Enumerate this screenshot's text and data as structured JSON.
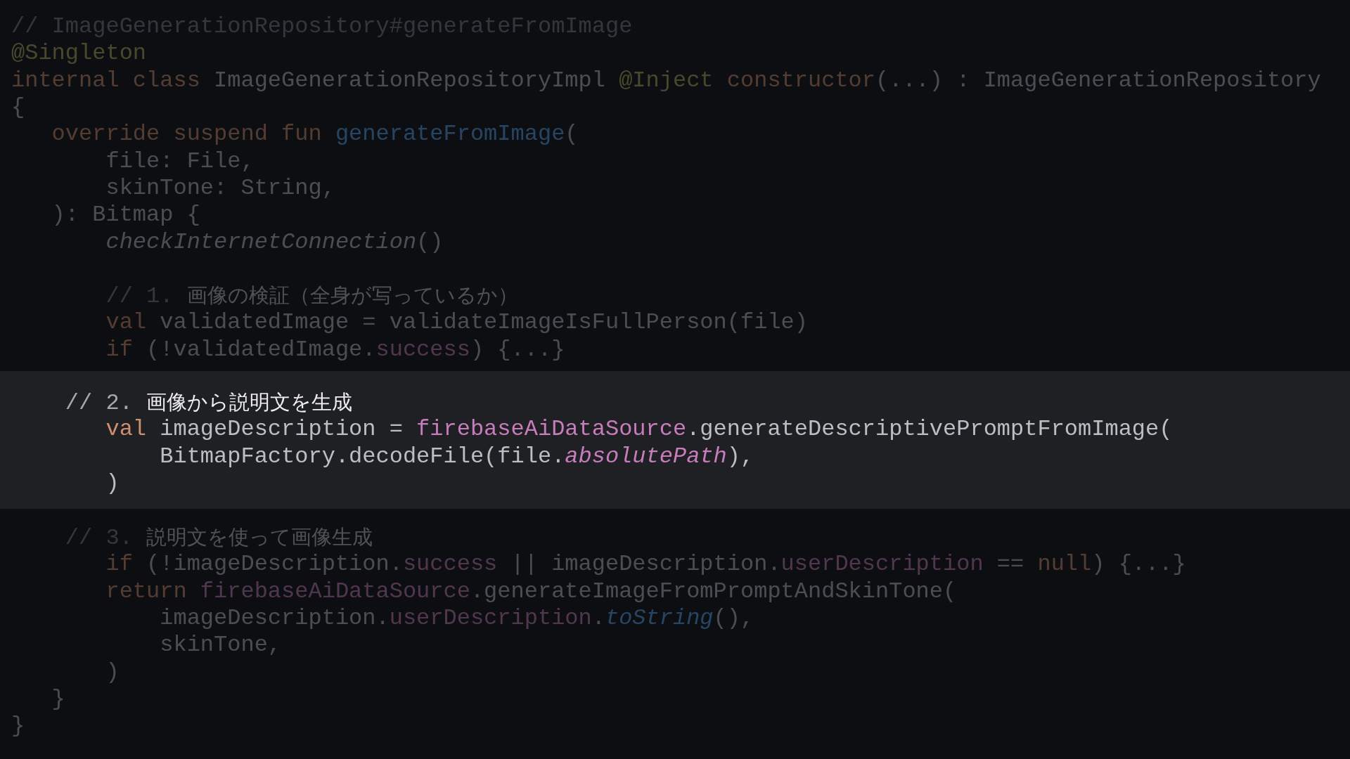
{
  "sections": [
    {
      "highlighted": false,
      "lines": [
        {
          "tokens": [
            {
              "kind": "comment",
              "text": "// ImageGenerationRepository#generateFromImage"
            }
          ]
        },
        {
          "tokens": [
            {
              "kind": "annotation",
              "text": "@Singleton"
            }
          ]
        },
        {
          "tokens": [
            {
              "kind": "keyword",
              "text": "internal class "
            },
            {
              "kind": "plain",
              "text": "ImageGenerationRepositoryImpl "
            },
            {
              "kind": "annotation",
              "text": "@Inject "
            },
            {
              "kind": "keyword",
              "text": "constructor"
            },
            {
              "kind": "plain",
              "text": "(...) : ImageGenerationRepository"
            }
          ]
        },
        {
          "tokens": [
            {
              "kind": "plain",
              "text": "{"
            }
          ]
        },
        {
          "tokens": [
            {
              "kind": "keyword",
              "text": "   override suspend fun "
            },
            {
              "kind": "function",
              "text": "generateFromImage"
            },
            {
              "kind": "plain",
              "text": "("
            }
          ]
        },
        {
          "tokens": [
            {
              "kind": "plain",
              "text": "       file: File,"
            }
          ]
        },
        {
          "tokens": [
            {
              "kind": "plain",
              "text": "       skinTone: String,"
            }
          ]
        },
        {
          "tokens": [
            {
              "kind": "plain",
              "text": "   ): Bitmap {"
            }
          ]
        },
        {
          "tokens": [
            {
              "kind": "italic",
              "text": "       checkInternetConnection"
            },
            {
              "kind": "plain",
              "text": "()"
            }
          ]
        },
        {
          "blank_before": true,
          "tokens": [
            {
              "kind": "comment",
              "text": "       // 1. "
            },
            {
              "kind": "comment-jp",
              "text": "画像の検証（全身が写っているか）"
            }
          ]
        },
        {
          "tokens": [
            {
              "kind": "keyword",
              "text": "       val "
            },
            {
              "kind": "plain",
              "text": "validatedImage = validateImageIsFullPerson(file)"
            }
          ]
        },
        {
          "tokens": [
            {
              "kind": "keyword",
              "text": "       if "
            },
            {
              "kind": "plain",
              "text": "(!validatedImage."
            },
            {
              "kind": "property",
              "text": "success"
            },
            {
              "kind": "plain",
              "text": ") {...}"
            }
          ]
        }
      ]
    },
    {
      "highlighted": true,
      "lines": [
        {
          "tokens": [
            {
              "kind": "comment",
              "text": "    // 2. "
            },
            {
              "kind": "comment-jp",
              "text": "画像から説明文を生成"
            }
          ]
        },
        {
          "tokens": [
            {
              "kind": "keyword",
              "text": "       val "
            },
            {
              "kind": "plain",
              "text": "imageDescription = "
            },
            {
              "kind": "property",
              "text": "firebaseAiDataSource"
            },
            {
              "kind": "plain",
              "text": ".generateDescriptivePromptFromImage("
            }
          ]
        },
        {
          "tokens": [
            {
              "kind": "plain",
              "text": "           BitmapFactory.decodeFile(file."
            },
            {
              "kind": "italic-property",
              "text": "absolutePath"
            },
            {
              "kind": "plain",
              "text": "),"
            }
          ]
        },
        {
          "tokens": [
            {
              "kind": "plain",
              "text": "       )"
            }
          ]
        }
      ]
    },
    {
      "highlighted": false,
      "lines": [
        {
          "tokens": [
            {
              "kind": "comment",
              "text": "    // 3. "
            },
            {
              "kind": "comment-jp",
              "text": "説明文を使って画像生成"
            }
          ]
        },
        {
          "tokens": [
            {
              "kind": "keyword",
              "text": "       if "
            },
            {
              "kind": "plain",
              "text": "(!imageDescription."
            },
            {
              "kind": "property",
              "text": "success"
            },
            {
              "kind": "plain",
              "text": " || imageDescription."
            },
            {
              "kind": "property",
              "text": "userDescription"
            },
            {
              "kind": "plain",
              "text": " == "
            },
            {
              "kind": "keyword",
              "text": "null"
            },
            {
              "kind": "plain",
              "text": ") {...}"
            }
          ]
        },
        {
          "tokens": [
            {
              "kind": "keyword",
              "text": "       return "
            },
            {
              "kind": "property",
              "text": "firebaseAiDataSource"
            },
            {
              "kind": "plain",
              "text": ".generateImageFromPromptAndSkinTone("
            }
          ]
        },
        {
          "tokens": [
            {
              "kind": "plain",
              "text": "           imageDescription."
            },
            {
              "kind": "property",
              "text": "userDescription"
            },
            {
              "kind": "plain",
              "text": "."
            },
            {
              "kind": "italic-function",
              "text": "toString"
            },
            {
              "kind": "plain",
              "text": "(),"
            }
          ]
        },
        {
          "tokens": [
            {
              "kind": "plain",
              "text": "           skinTone,"
            }
          ]
        },
        {
          "tokens": [
            {
              "kind": "plain",
              "text": "       )"
            }
          ]
        },
        {
          "tokens": [
            {
              "kind": "plain",
              "text": "   }"
            }
          ]
        },
        {
          "tokens": [
            {
              "kind": "plain",
              "text": "}"
            }
          ]
        }
      ]
    }
  ]
}
